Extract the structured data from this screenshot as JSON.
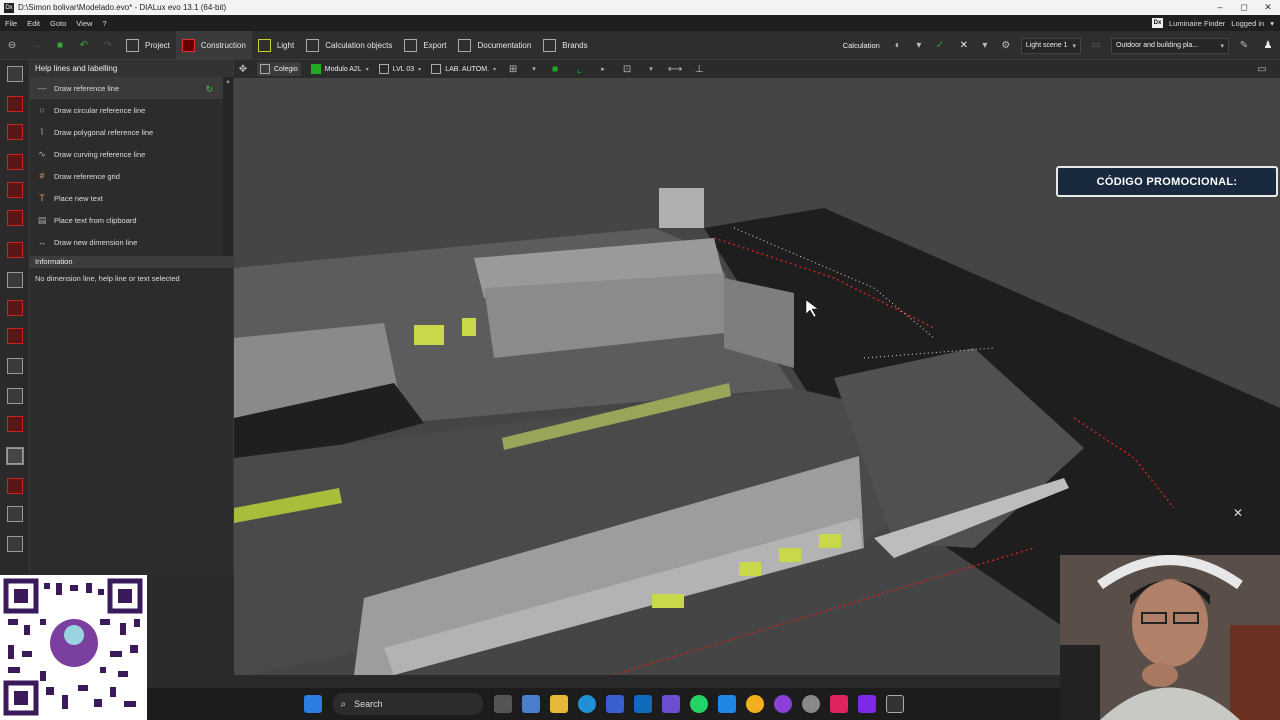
{
  "window": {
    "title": "D:\\Simon bolivar\\Modelado.evo* - DIALux evo 13.1  (64-bit)",
    "controls": [
      "–",
      "◻",
      "✕"
    ]
  },
  "menu": {
    "items": [
      "File",
      "Edit",
      "Goto",
      "View",
      "?"
    ],
    "luminaire_finder": "Luminaire Finder",
    "logged_in": "Logged in"
  },
  "toolbar": {
    "tabs": [
      "Project",
      "Construction",
      "Light",
      "Calculation objects",
      "Export",
      "Documentation",
      "Brands"
    ],
    "active_tab": "Construction",
    "calculation": "Calculation",
    "light_scene": "Light scene 1",
    "planning_mode": "Outdoor and building pla..."
  },
  "panel": {
    "title": "Help lines and labelling",
    "commands": [
      "Draw reference line",
      "Draw circular reference line",
      "Draw polygonal reference line",
      "Draw curving reference line",
      "Draw reference grid",
      "Place new text",
      "Place text from clipboard",
      "Draw new dimension line"
    ],
    "info_title": "Information",
    "info_text": "No dimension line, help line or text selected"
  },
  "viewbar": {
    "building": "Colegio",
    "module": "Modulo A2L",
    "level": "LVL 03",
    "room": "LAB. AUTOM."
  },
  "overlay": {
    "promo": "CÓDIGO PROMOCIONAL:",
    "close": "✕"
  },
  "taskbar": {
    "search": "Search"
  },
  "colors": {
    "accent_red": "#cc2222",
    "highlight_yellow": "#c8d84a",
    "viewport_bg": "#454545"
  }
}
